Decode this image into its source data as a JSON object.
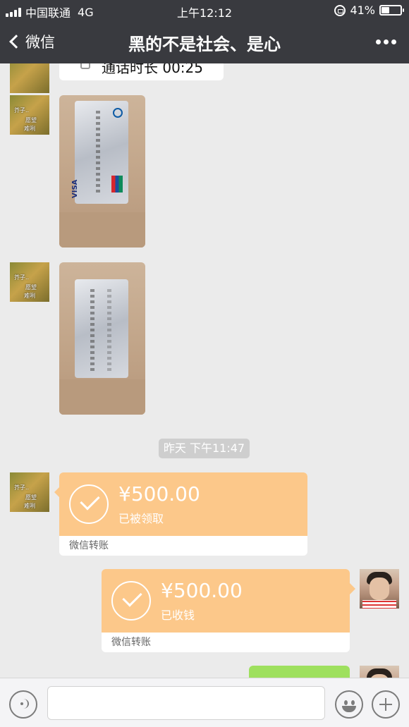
{
  "status_bar": {
    "carrier": "中国联通",
    "network": "4G",
    "time": "上午12:12",
    "battery_percent": "41%",
    "battery_level": 0.41
  },
  "nav": {
    "back_label": "微信",
    "title": "黑的不是社会、是心"
  },
  "messages": {
    "call_text": "通话时长 00:25",
    "avatar_left_text": [
      "芥子..",
      "愿望",
      "难咧"
    ],
    "time_divider": "昨天 下午11:47",
    "transfer_received": {
      "amount": "¥500.00",
      "status": "已被领取",
      "footer": "微信转账"
    },
    "transfer_sent": {
      "amount": "¥500.00",
      "status": "已收钱",
      "footer": "微信转账"
    }
  },
  "colors": {
    "nav_bg": "#393a3f",
    "chat_bg": "#ebebeb",
    "transfer_orange": "#fcc88a",
    "sent_green": "#9ee05e"
  },
  "icons": {
    "back": "chevron-left-icon",
    "more": "more-icon",
    "voice": "voice-icon",
    "emoji": "emoji-icon",
    "plus": "plus-icon",
    "check": "check-circle-icon"
  }
}
